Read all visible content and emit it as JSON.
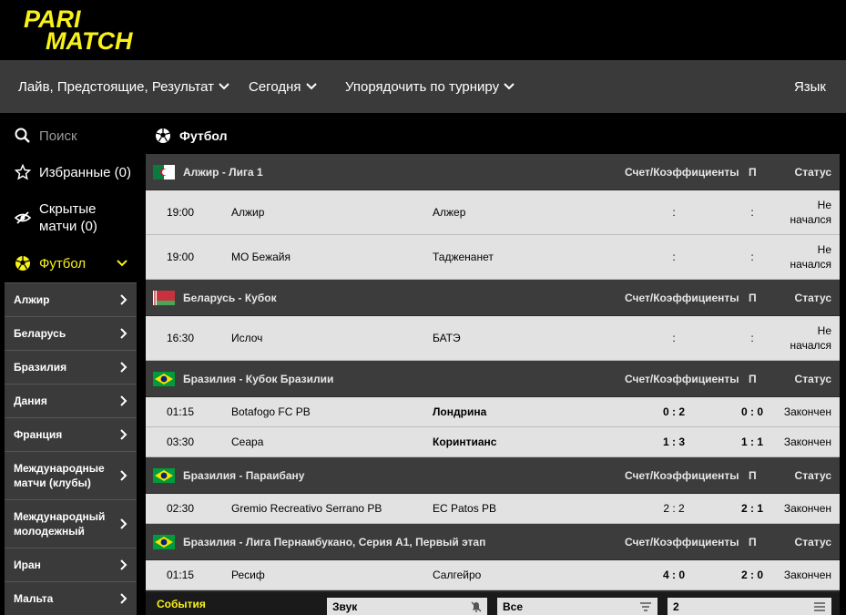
{
  "brand": {
    "logo_line1": "PARI",
    "logo_line2": "MATCH",
    "accent": "#f8f11a"
  },
  "nav": {
    "filter_label": "Лайв, Предстоящие, Результат",
    "date_label": "Сегодня",
    "sort_label": "Упорядочить по турниру",
    "lang_label": "Язык"
  },
  "sidebar": {
    "search_placeholder": "Поиск",
    "favorites_label": "Избранные (0)",
    "hidden_line1": "Скрытые",
    "hidden_line2": "матчи (0)",
    "sport_label": "Футбол",
    "countries": [
      {
        "label": "Алжир"
      },
      {
        "label": "Беларусь"
      },
      {
        "label": "Бразилия"
      },
      {
        "label": "Дания"
      },
      {
        "label": "Франция"
      },
      {
        "line1": "Международные",
        "line2": "матчи (клубы)"
      },
      {
        "line1": "Международный",
        "line2": "молодежный"
      },
      {
        "label": "Иран"
      },
      {
        "label": "Мальта"
      }
    ]
  },
  "main": {
    "sport_title": "Футбол",
    "col_score": "Счет/Коэффициенты",
    "col_p": "П",
    "col_status": "Статус",
    "leagues": [
      {
        "name": "Алжир - Лига 1",
        "matches": [
          {
            "time": "19:00",
            "home": "Алжир",
            "away": "Алжер",
            "score": ":",
            "p": ":",
            "status1": "Не",
            "status2": "начался"
          },
          {
            "time": "19:00",
            "home": "МО Бежайя",
            "away": "Тадженанет",
            "score": ":",
            "p": ":",
            "status1": "Не",
            "status2": "начался"
          }
        ]
      },
      {
        "name": "Беларусь - Кубок",
        "matches": [
          {
            "time": "16:30",
            "home": "Ислоч",
            "away": "БАТЭ",
            "score": ":",
            "p": ":",
            "status1": "Не",
            "status2": "начался"
          }
        ]
      },
      {
        "name": "Бразилия - Кубок Бразилии",
        "matches": [
          {
            "time": "01:15",
            "home": "Botafogo FC PB",
            "away": "Лондрина",
            "score": "0 : 2",
            "p": "0 : 0",
            "status": "Закончен"
          },
          {
            "time": "03:30",
            "home": "Сеара",
            "away": "Коринтианс",
            "score": "1 : 3",
            "p": "1 : 1",
            "status": "Закончен"
          }
        ]
      },
      {
        "name": "Бразилия - Параибану",
        "matches": [
          {
            "time": "02:30",
            "home": "Gremio Recreativo Serrano PB",
            "away": "EC Patos PB",
            "score": "2 : 2",
            "p": "2 : 1",
            "status": "Закончен"
          }
        ]
      },
      {
        "name": "Бразилия - Лига Пернамбукано, Серия А1, Первый этап",
        "matches": [
          {
            "time": "01:15",
            "home": "Ресиф",
            "away": "Салгейро",
            "score": "4 : 0",
            "p": "2 : 0",
            "status": "Закончен"
          }
        ]
      }
    ]
  },
  "bottom": {
    "events_label": "События",
    "sound_label": "Звук",
    "filter_value": "Все",
    "count_value": "2"
  }
}
